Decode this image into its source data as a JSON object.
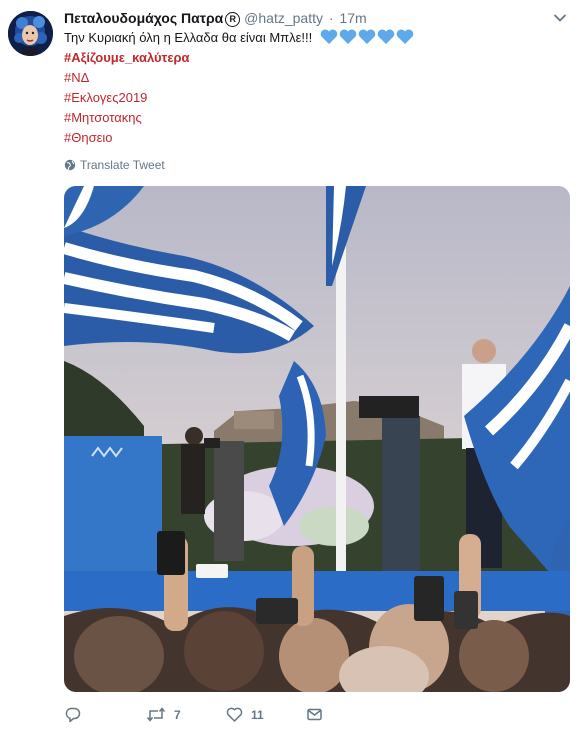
{
  "tweet": {
    "display_name": "Πεταλουδομάχος Πατρα",
    "verified_glyph": "R",
    "handle": "@hatz_patty",
    "separator": "·",
    "time": "17m",
    "text": "Την Κυριακή όλη η Ελλαδα θα είναι Μπλε!!!",
    "hashtags": [
      "#Αξίζουμε_καλύτερα",
      "#ΝΔ",
      "#Εκλογες2019",
      "#Μητσοτακης",
      "#Θησειο"
    ],
    "translate_label": "Translate Tweet",
    "reply_count": "",
    "retweet_count": "7",
    "like_count": "11"
  },
  "colors": {
    "hashtag": "#c0282e",
    "muted": "#657786",
    "heart_blue": "#5da9e9",
    "flag_blue": "#2a5ca8"
  },
  "icons": [
    "avatar-image",
    "chevron-down-icon",
    "blue-heart-icon",
    "globe-icon",
    "reply-icon",
    "retweet-icon",
    "like-icon",
    "message-icon"
  ]
}
